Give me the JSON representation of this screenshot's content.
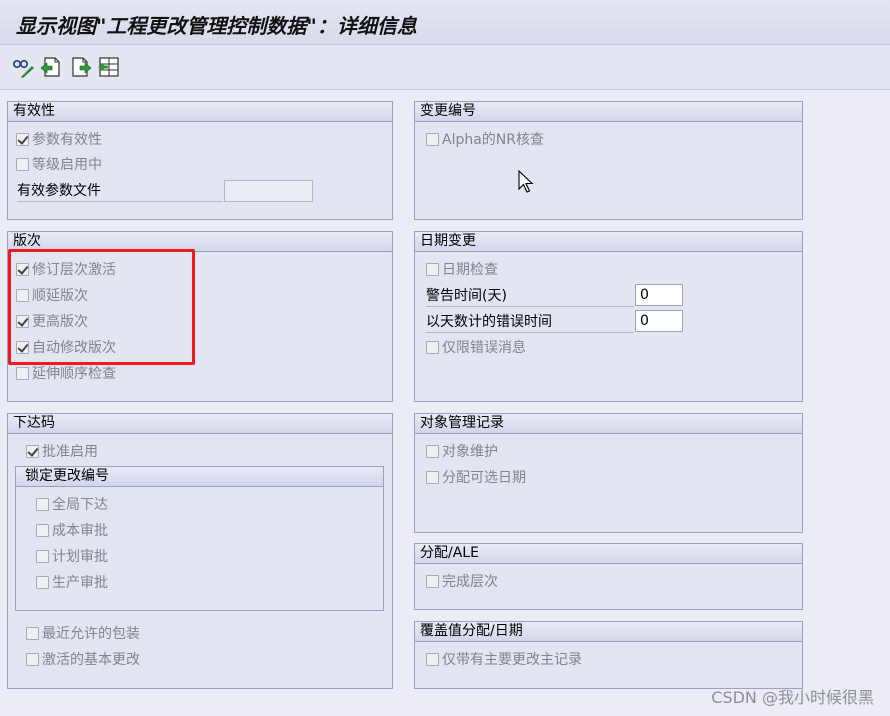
{
  "window": {
    "title": "显示视图\"工程更改管理控制数据\"：详细信息"
  },
  "toolbar": {
    "buttons": [
      {
        "icon": "glasses-change-icon"
      },
      {
        "icon": "previous-entry-icon"
      },
      {
        "icon": "next-entry-icon"
      },
      {
        "icon": "select-entry-icon"
      }
    ]
  },
  "groups": {
    "validity": {
      "title": "有效性",
      "items": [
        {
          "label": "参数有效性",
          "checked": true
        },
        {
          "label": "等级启用中",
          "checked": false
        }
      ],
      "field": {
        "label": "有效参数文件",
        "value": ""
      }
    },
    "change_number": {
      "title": "变更编号",
      "items": [
        {
          "label": "Alpha的NR核查",
          "checked": false
        }
      ]
    },
    "revision": {
      "title": "版次",
      "items": [
        {
          "label": "修订层次激活",
          "checked": true
        },
        {
          "label": "顺延版次",
          "checked": false
        },
        {
          "label": "更高版次",
          "checked": true
        },
        {
          "label": "自动修改版次",
          "checked": true
        },
        {
          "label": "延伸顺序检查",
          "checked": false
        }
      ]
    },
    "date_change": {
      "title": "日期变更",
      "check": {
        "label": "日期检查",
        "checked": false
      },
      "fields": [
        {
          "label": "警告时间(天)",
          "value": "0"
        },
        {
          "label": "以天数计的错误时间",
          "value": "0"
        }
      ],
      "check2": {
        "label": "仅限错误消息",
        "checked": false
      }
    },
    "release_key": {
      "title": "下达码",
      "item": {
        "label": "批准启用",
        "checked": true
      },
      "lock": {
        "title": "锁定更改编号",
        "items": [
          {
            "label": "全局下达",
            "checked": false
          },
          {
            "label": "成本审批",
            "checked": false
          },
          {
            "label": "计划审批",
            "checked": false
          },
          {
            "label": "生产审批",
            "checked": false
          }
        ]
      },
      "bottom_items": [
        {
          "label": "最近允许的包装",
          "checked": false
        },
        {
          "label": "激活的基本更改",
          "checked": false
        }
      ]
    },
    "object_mgmt": {
      "title": "对象管理记录",
      "items": [
        {
          "label": "对象维护",
          "checked": false
        },
        {
          "label": "分配可选日期",
          "checked": false
        }
      ]
    },
    "distribution": {
      "title": "分配/ALE",
      "items": [
        {
          "label": "完成层次",
          "checked": false
        }
      ]
    },
    "override": {
      "title": "覆盖值分配/日期",
      "items": [
        {
          "label": "仅带有主要更改主记录",
          "checked": false
        }
      ]
    }
  },
  "watermark": "CSDN @我小时候很黑"
}
